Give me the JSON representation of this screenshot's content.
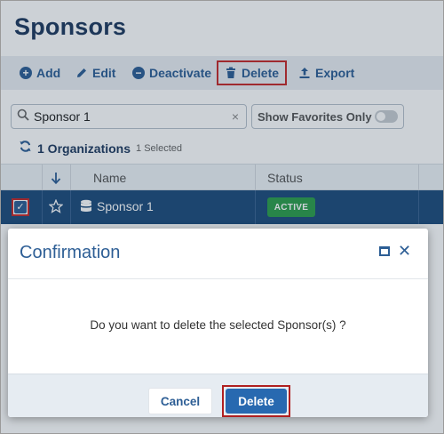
{
  "page": {
    "title": "Sponsors"
  },
  "toolbar": {
    "add_label": "Add",
    "edit_label": "Edit",
    "deactivate_label": "Deactivate",
    "delete_label": "Delete",
    "export_label": "Export"
  },
  "search": {
    "value": "Sponsor 1",
    "clear": "×"
  },
  "favorites": {
    "label": "Show Favorites Only",
    "enabled": false
  },
  "summary": {
    "count_label": "1 Organizations",
    "selected_label": "1 Selected"
  },
  "table": {
    "columns": [
      "Name",
      "Status"
    ],
    "rows": [
      {
        "name": "Sponsor 1",
        "status": "ACTIVE",
        "selected": true
      }
    ]
  },
  "dialog": {
    "title": "Confirmation",
    "message": "Do you want to delete the selected Sponsor(s) ?",
    "cancel_label": "Cancel",
    "confirm_label": "Delete"
  },
  "colors": {
    "brand": "#2d5e95",
    "title": "#1f3a5f",
    "selected_row": "#1e4c7c",
    "active_badge": "#2e9e4b",
    "highlight": "#c62a2a"
  }
}
